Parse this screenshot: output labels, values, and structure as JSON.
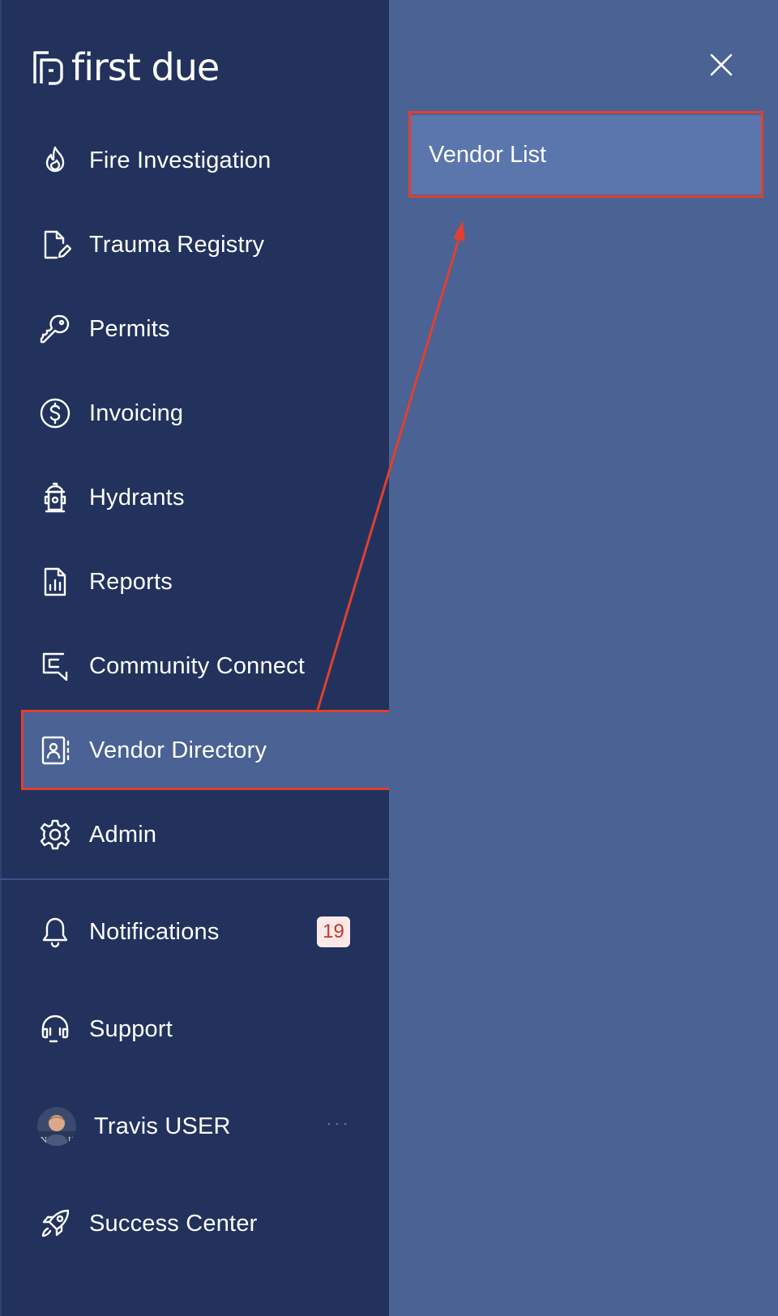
{
  "brand": {
    "name": "first due"
  },
  "nav": {
    "items": [
      {
        "label": "Fire Investigation",
        "icon": "flame-icon"
      },
      {
        "label": "Trauma Registry",
        "icon": "file-edit-icon"
      },
      {
        "label": "Permits",
        "icon": "key-icon"
      },
      {
        "label": "Invoicing",
        "icon": "dollar-circle-icon"
      },
      {
        "label": "Hydrants",
        "icon": "hydrant-icon"
      },
      {
        "label": "Reports",
        "icon": "report-chart-icon"
      },
      {
        "label": "Community Connect",
        "icon": "community-connect-icon"
      },
      {
        "label": "Vendor Directory",
        "icon": "contact-book-icon",
        "active": true
      },
      {
        "label": "Admin",
        "icon": "gear-icon"
      }
    ],
    "bottom": [
      {
        "label": "Notifications",
        "icon": "bell-icon",
        "badge": "19"
      },
      {
        "label": "Support",
        "icon": "headset-icon"
      },
      {
        "label": "Travis USER",
        "icon": "avatar",
        "more": "···"
      },
      {
        "label": "Success Center",
        "icon": "rocket-icon"
      }
    ]
  },
  "submenu": {
    "items": [
      {
        "label": "Vendor List"
      }
    ]
  },
  "colors": {
    "sidebar_bg": "#22325d",
    "panel_bg": "#4a6294",
    "active_item_bg": "#4a6294",
    "submenu_item_bg": "#5a76ad",
    "annotation_red": "#e0402f",
    "badge_bg": "#fde8e8",
    "badge_text": "#c0392b"
  }
}
